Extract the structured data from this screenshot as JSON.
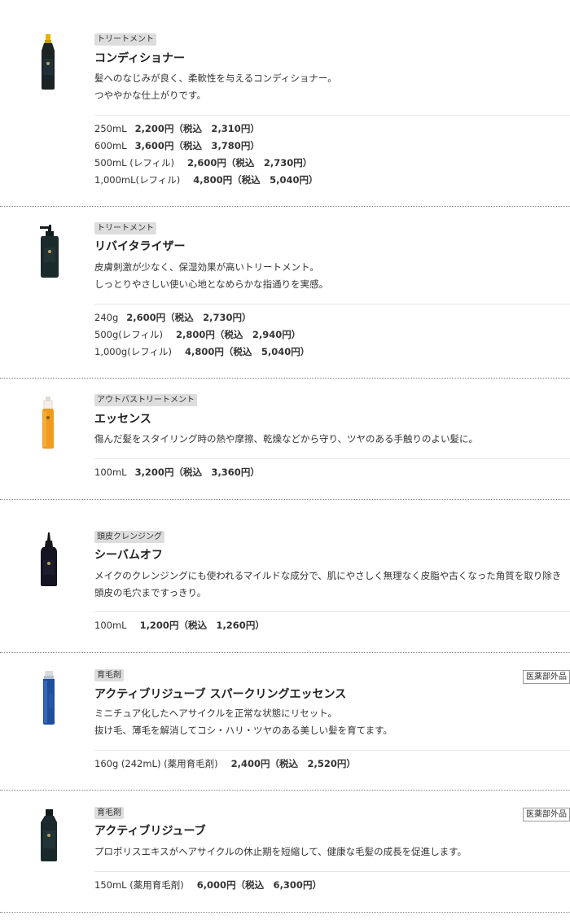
{
  "products": [
    {
      "tag": "トリートメント",
      "name": "コンディショナー",
      "desc": [
        "髪へのなじみが良く、柔軟性を与えるコンディショナー。",
        "つややかな仕上がりです。"
      ],
      "prices": [
        {
          "size": "250mL",
          "price": "2,200円（税込　2,310円）"
        },
        {
          "size": "600mL",
          "price": "3,600円（税込　3,780円）"
        },
        {
          "size": "500mL (レフィル)",
          "price": "2,600円（税込　2,730円）"
        },
        {
          "size": "1,000mL(レフィル)",
          "price": "4,800円（税込　5,040円）"
        }
      ],
      "icon": "bottle-conditioner-icon"
    },
    {
      "tag": "トリートメント",
      "name": "リバイタライザー",
      "desc": [
        "皮膚刺激が少なく、保湿効果が高いトリートメント。",
        "しっとりやさしい使い心地となめらかな指通りを実感。"
      ],
      "prices": [
        {
          "size": "240g",
          "price": "2,600円（税込　2,730円）"
        },
        {
          "size": "500g(レフィル)",
          "price": "2,800円（税込　2,940円）"
        },
        {
          "size": "1,000g(レフィル)",
          "price": "4,800円（税込　5,040円）"
        }
      ],
      "icon": "pump-bottle-icon"
    },
    {
      "tag": "アウトバストリートメント",
      "name": "エッセンス",
      "desc": [
        "傷んだ髪をスタイリング時の熱や摩擦、乾燥などから守り、ツヤのある手触りのよい髪に。"
      ],
      "prices": [
        {
          "size": "100mL",
          "price": "3,200円（税込　3,360円）"
        }
      ],
      "icon": "spray-bottle-orange-icon"
    },
    {
      "tag": "頭皮クレンジング",
      "name": "シーバムオフ",
      "desc": [
        "メイクのクレンジングにも使われるマイルドな成分で、肌にやさしく無理なく皮脂や古くなった角質を取り除き",
        "頭皮の毛穴まですっきり。"
      ],
      "prices": [
        {
          "size": "100mL",
          "price": "1,200円（税込　1,260円）"
        }
      ],
      "icon": "nozzle-bottle-icon"
    },
    {
      "tag": "育毛剤",
      "name": "アクティブリジューブ スパークリングエッセンス",
      "badge": "医薬部外品",
      "desc": [
        "ミニチュア化したヘアサイクルを正常な状態にリセット。",
        "抜け毛、薄毛を解消してコシ・ハリ・ツヤのある美しい髪を育てます。"
      ],
      "prices": [
        {
          "size": "160g (242mL) (薬用育毛剤)",
          "price": "2,400円（税込　2,520円）"
        }
      ],
      "icon": "aerosol-can-blue-icon"
    },
    {
      "tag": "育毛剤",
      "name": "アクティブリジューブ",
      "badge": "医薬部外品",
      "desc": [
        "プロポリスエキスがヘアサイクルの休止期を短縮して、健康な毛髪の成長を促進します。"
      ],
      "prices": [
        {
          "size": "150mL (薬用育毛剤)",
          "price": "6,000円（税込　6,300円）"
        }
      ],
      "icon": "bottle-dark-icon"
    }
  ],
  "colors": {
    "tag_bg": "#dddddd",
    "separator": "#888888",
    "text": "#333333"
  }
}
